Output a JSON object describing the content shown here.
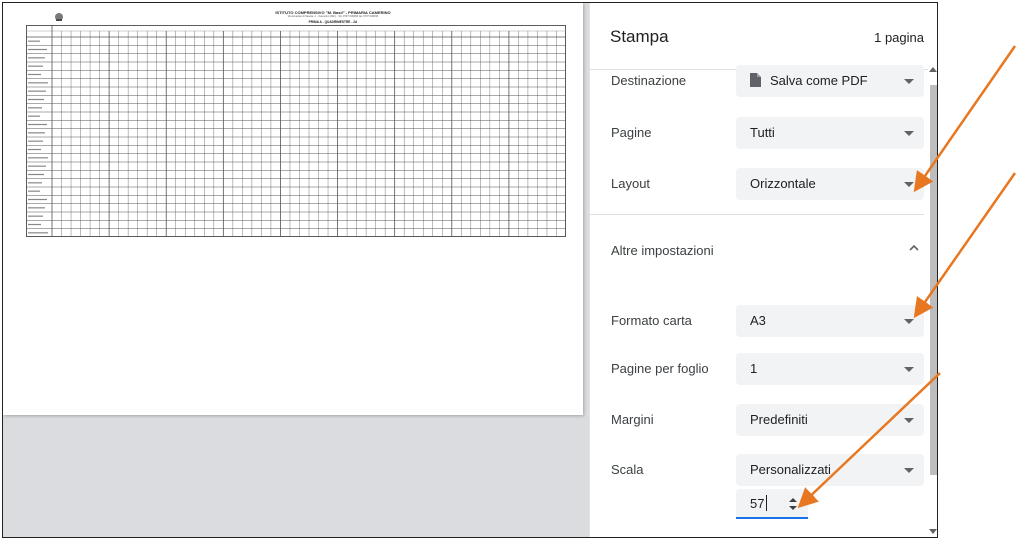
{
  "document": {
    "title": "ISTITUTO COMPRENSIVO \"M. Basil\" - PRIMARIA CAMERINO",
    "subtitle": "Via Amedeo di Savoia, 2 - Camerino (MC) - Tel. 0737 630456 fax 0737 630456",
    "section": "PRIMA A - QUADRIMESTRE - 2A"
  },
  "print_panel": {
    "title": "Stampa",
    "page_count": "1 pagina",
    "destination": {
      "label": "Destinazione",
      "value": "Salva come PDF"
    },
    "pages": {
      "label": "Pagine",
      "value": "Tutti"
    },
    "layout": {
      "label": "Layout",
      "value": "Orizzontale"
    },
    "more_settings": {
      "label": "Altre impostazioni"
    },
    "paper_size": {
      "label": "Formato carta",
      "value": "A3"
    },
    "pages_per_sheet": {
      "label": "Pagine per foglio",
      "value": "1"
    },
    "margins": {
      "label": "Margini",
      "value": "Predefiniti"
    },
    "scale": {
      "label": "Scala",
      "value": "Personalizzati",
      "custom_value": "57"
    }
  },
  "colors": {
    "accent": "#1a73e8",
    "field_bg": "#f1f3f4",
    "annotation_arrow": "#e87722",
    "preview_bg": "#dadce0"
  }
}
